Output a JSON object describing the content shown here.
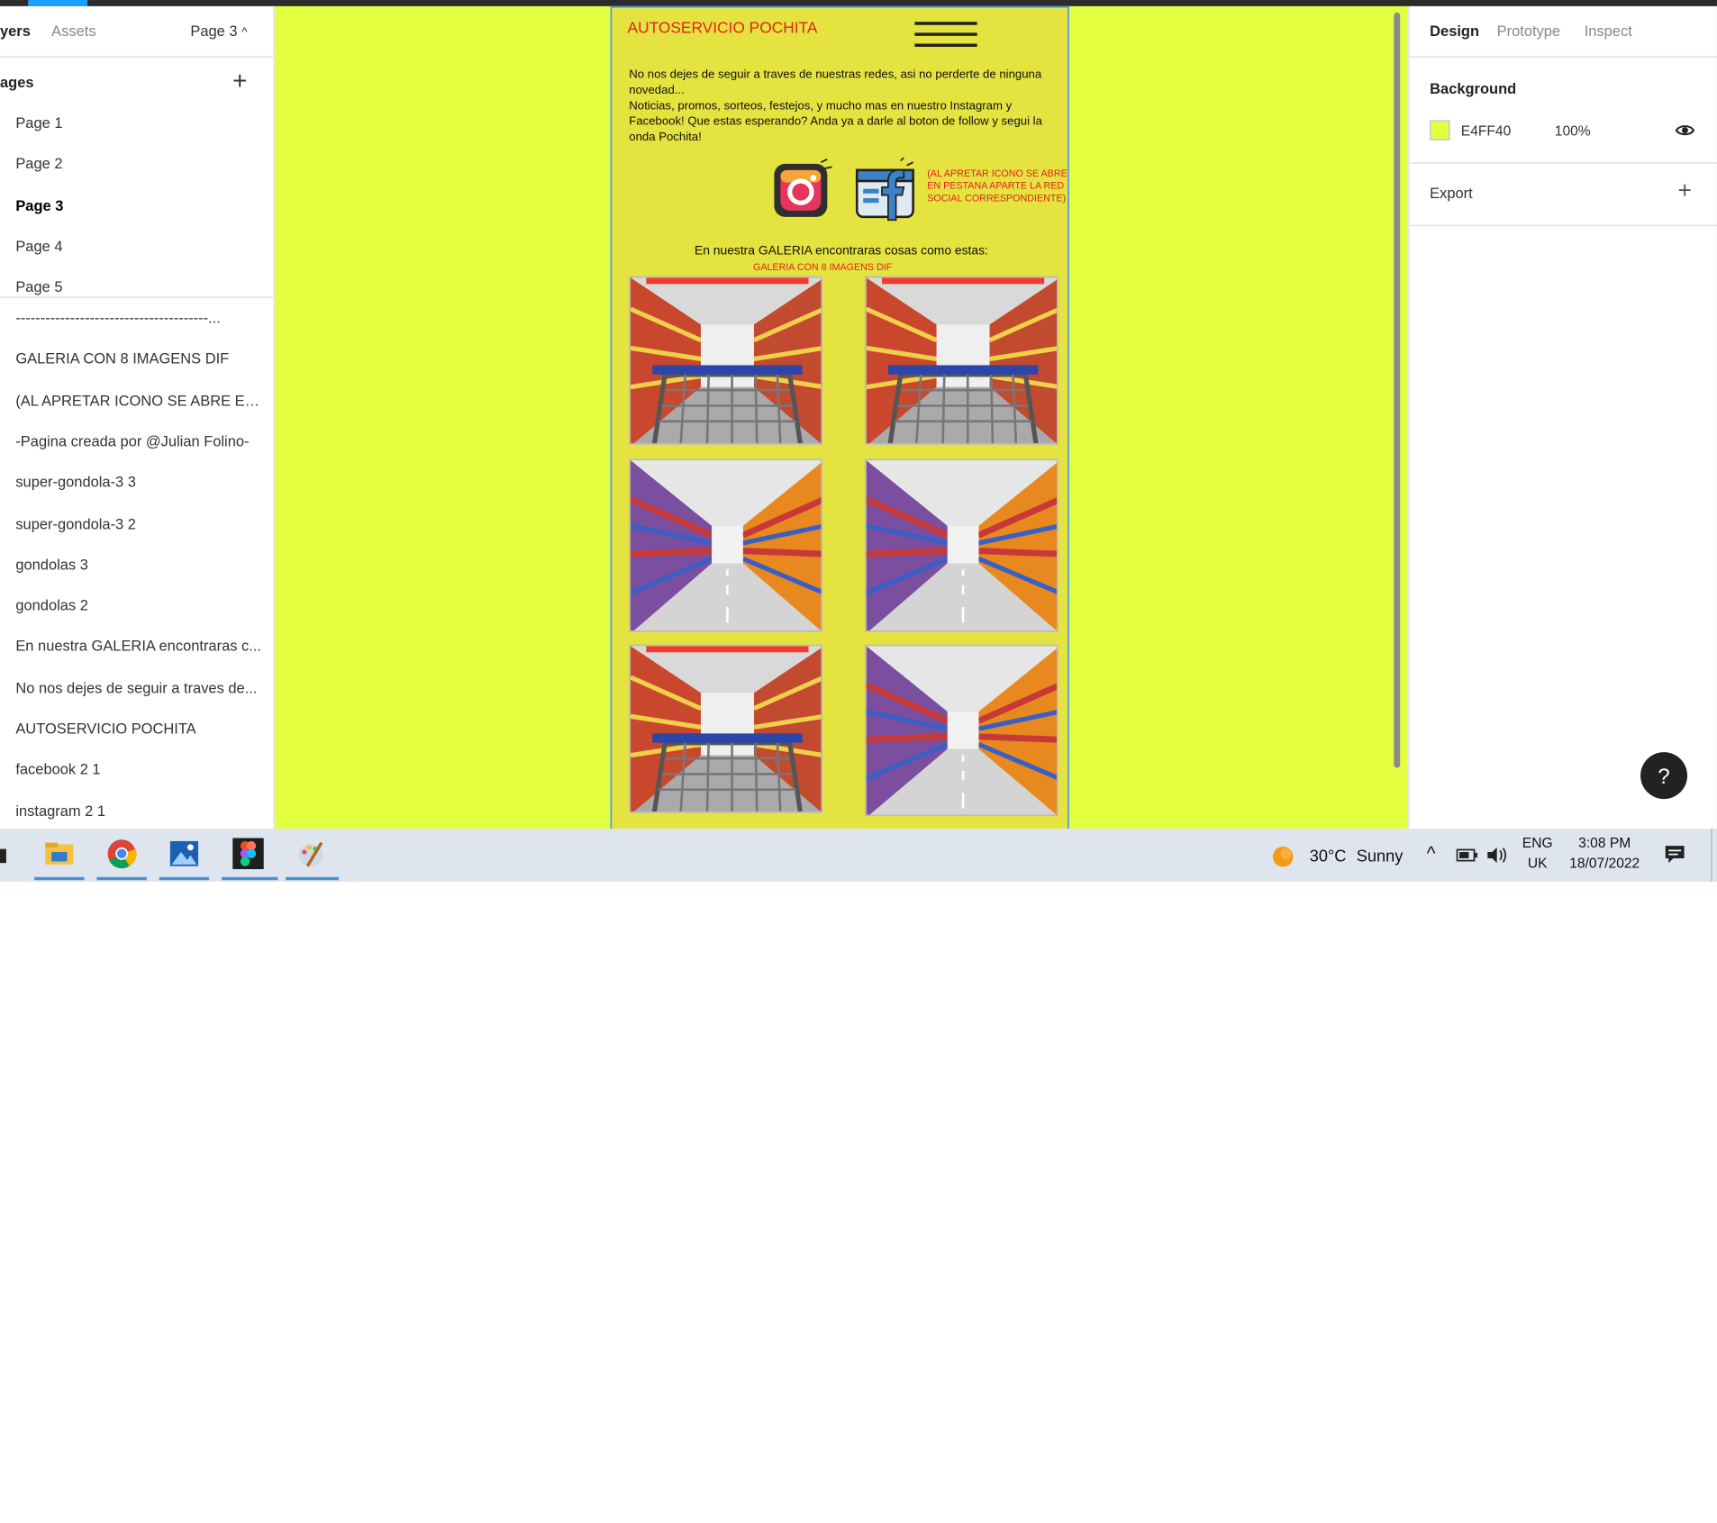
{
  "app": {
    "left_panel": {
      "tabs": [
        "yers",
        "Assets"
      ],
      "current_page": "Page 3",
      "pages_header": "ages",
      "pages": [
        "Page 1",
        "Page 2",
        "Page 3",
        "Page 4",
        "Page 5"
      ],
      "selected_page": "Page 3",
      "layers": [
        "---------------------------------------...",
        "GALERIA CON 8 IMAGENS DIF",
        "(AL APRETAR ICONO SE ABRE EN ...",
        "-Pagina creada por @Julian Folino-",
        "super-gondola-3 3",
        "super-gondola-3 2",
        "gondolas 3",
        "gondolas 2",
        "En nuestra GALERIA encontraras c...",
        "No nos dejes de seguir a traves de...",
        "AUTOSERVICIO POCHITA",
        "facebook 2 1",
        "instagram 2 1"
      ]
    },
    "frame": {
      "title": "AUTOSERVICIO POCHITA",
      "paragraph_line1": "No nos dejes de seguir a traves de nuestras redes, asi no perderte de ninguna novedad...",
      "paragraph_line2": "Noticias, promos, sorteos, festejos, y mucho mas en nuestro Instagram y Facebook! Que estas esperando? Anda ya a darle al boton de follow y segui la onda Pochita!",
      "icon_note": "(AL APRETAR ICONO SE ABRE EN PESTANA APARTE LA RED SOCIAL CORRESPONDIENTE)",
      "gallery_heading": "En nuestra GALERIA encontraras cosas como estas:",
      "gallery_sub": "GALERIA CON 8 IMAGENS DIF",
      "gallery_images": [
        "super-aisle",
        "super-aisle",
        "gondolas",
        "gondolas",
        "super-aisle",
        "gondolas"
      ]
    },
    "right_panel": {
      "tabs": [
        "Design",
        "Prototype",
        "Inspect"
      ],
      "active_tab": "Design",
      "background_label": "Background",
      "background_hex": "E4FF40",
      "background_opacity": "100%",
      "export_label": "Export",
      "help_label": "?"
    },
    "colors": {
      "canvas_bg": "#e4ff40",
      "frame_bg": "#e5e340",
      "accent": "#18a0fb",
      "title_red": "#e5231b"
    }
  },
  "taskbar": {
    "apps": [
      "file-explorer-icon",
      "chrome-icon",
      "photos-icon",
      "figma-icon",
      "paint-icon"
    ],
    "weather_temp": "30°C",
    "weather_text": "Sunny",
    "lang_line1": "ENG",
    "lang_line2": "UK",
    "time": "3:08 PM",
    "date": "18/07/2022"
  }
}
